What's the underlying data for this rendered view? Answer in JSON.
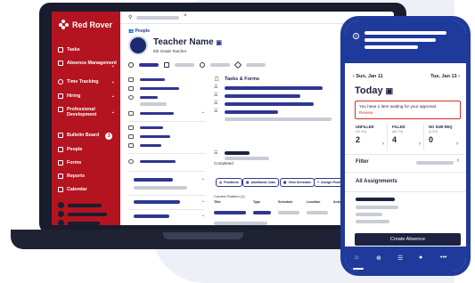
{
  "brand": {
    "name": "Red Rover"
  },
  "sidebar": {
    "items": [
      {
        "label": "Tasks"
      },
      {
        "label": "Absence Management"
      },
      {
        "label": "Time Tracking"
      },
      {
        "label": "Hiring"
      },
      {
        "label": "Professional Development"
      },
      {
        "label": "Bulletin Board",
        "badge": "3"
      },
      {
        "label": "People"
      },
      {
        "label": "Forms"
      },
      {
        "label": "Reports"
      },
      {
        "label": "Calendar"
      }
    ]
  },
  "profile": {
    "breadcrumb": "People",
    "name": "Teacher Name",
    "subtitle": "5th Grade Teacher"
  },
  "tasks": {
    "title": "Tasks & Forms",
    "completed_label": "Completed",
    "buttons": [
      "Positions",
      "Additional Jobs",
      "View Schedule",
      "Assign Position"
    ],
    "current_position_label": "Current Position (1)",
    "columns": [
      "Title",
      "Type",
      "Schedule",
      "Location",
      "Action"
    ]
  },
  "phone": {
    "prev_date": "Sun, Jan 11",
    "next_date": "Tue, Jan 13",
    "heading": "Today",
    "alert": {
      "message": "You have 1 item waiting for your approval.",
      "action": "Review"
    },
    "stats": [
      {
        "label": "UNFILLED",
        "sub": "(33.3%)",
        "value": "2"
      },
      {
        "label": "FILLED",
        "sub": "(66.7%)",
        "value": "4"
      },
      {
        "label": "NO SUB REQ",
        "sub": "(0.0%)",
        "value": "0"
      }
    ],
    "filter_label": "Filter",
    "assignments_label": "All Assignments",
    "create_button": "Create Absence"
  },
  "colors": {
    "brand_red": "#b3141f",
    "navy": "#1f3a9a",
    "dark": "#181c2c"
  }
}
